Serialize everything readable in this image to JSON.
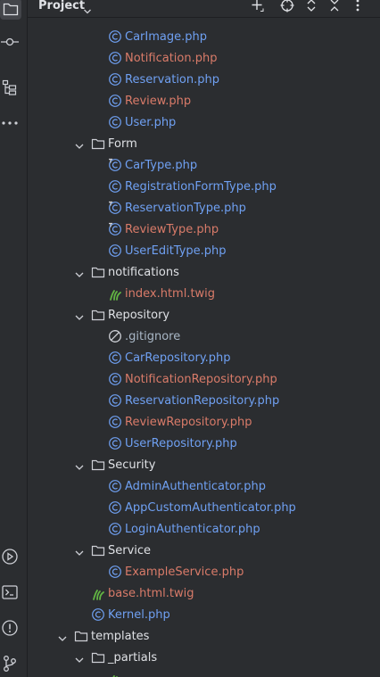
{
  "header": {
    "title": "Project"
  },
  "icons": {
    "sidebar": [
      "folder-icon",
      "commit-icon",
      "structure-icon",
      "more-icon",
      "run-icon",
      "terminal-icon",
      "problems-icon",
      "git-icon"
    ],
    "header": [
      "add-icon",
      "locate-icon",
      "expand-icon",
      "collapse-icon",
      "more-vertical-icon"
    ]
  },
  "colors": {
    "file": "#6fa0f2",
    "modified": "#d97b69",
    "folder_text": "#dfe1e5",
    "background": "#2b2d30"
  },
  "tree": [
    {
      "label": "CarImage.php",
      "kind": "php",
      "status": "file"
    },
    {
      "label": "Notification.php",
      "kind": "php",
      "status": "modified"
    },
    {
      "label": "Reservation.php",
      "kind": "php",
      "status": "file"
    },
    {
      "label": "Review.php",
      "kind": "php",
      "status": "modified"
    },
    {
      "label": "User.php",
      "kind": "php",
      "status": "file"
    },
    {
      "label": "Form",
      "kind": "folder",
      "status": "dir"
    },
    {
      "label": "CarType.php",
      "kind": "php-form",
      "status": "file"
    },
    {
      "label": "RegistrationFormType.php",
      "kind": "php",
      "status": "file"
    },
    {
      "label": "ReservationType.php",
      "kind": "php-form",
      "status": "file"
    },
    {
      "label": "ReviewType.php",
      "kind": "php-form",
      "status": "modified"
    },
    {
      "label": "UserEditType.php",
      "kind": "php",
      "status": "file"
    },
    {
      "label": "notifications",
      "kind": "folder",
      "status": "dir"
    },
    {
      "label": "index.html.twig",
      "kind": "twig",
      "status": "modified"
    },
    {
      "label": "Repository",
      "kind": "folder",
      "status": "dir"
    },
    {
      "label": ".gitignore",
      "kind": "ignore",
      "status": "ignore"
    },
    {
      "label": "CarRepository.php",
      "kind": "php",
      "status": "file"
    },
    {
      "label": "NotificationRepository.php",
      "kind": "php",
      "status": "modified"
    },
    {
      "label": "ReservationRepository.php",
      "kind": "php",
      "status": "file"
    },
    {
      "label": "ReviewRepository.php",
      "kind": "php",
      "status": "modified"
    },
    {
      "label": "UserRepository.php",
      "kind": "php",
      "status": "file"
    },
    {
      "label": "Security",
      "kind": "folder",
      "status": "dir"
    },
    {
      "label": "AdminAuthenticator.php",
      "kind": "php",
      "status": "file"
    },
    {
      "label": "AppCustomAuthenticator.php",
      "kind": "php",
      "status": "file"
    },
    {
      "label": "LoginAuthenticator.php",
      "kind": "php",
      "status": "file"
    },
    {
      "label": "Service",
      "kind": "folder",
      "status": "dir"
    },
    {
      "label": "ExampleService.php",
      "kind": "php",
      "status": "modified"
    },
    {
      "label": "base.html.twig",
      "kind": "twig",
      "status": "modified"
    },
    {
      "label": "Kernel.php",
      "kind": "php",
      "status": "file"
    },
    {
      "label": "templates",
      "kind": "folder",
      "status": "dir"
    },
    {
      "label": "_partials",
      "kind": "folder",
      "status": "dir"
    }
  ]
}
